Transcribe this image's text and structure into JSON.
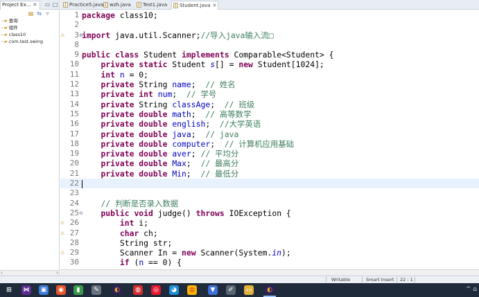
{
  "explorer": {
    "tab_label": "Project Ex...",
    "tab_close": "✕",
    "tree": [
      {
        "label": "查询",
        "arrow": "›"
      },
      {
        "label": "组件",
        "arrow": "›"
      },
      {
        "label": "class10",
        "arrow": "›"
      },
      {
        "label": "com.test.swing",
        "arrow": "›"
      }
    ]
  },
  "editor": {
    "tabs": [
      {
        "label": "Practice5.java",
        "active": false
      },
      {
        "label": "wzh.java",
        "active": false
      },
      {
        "label": "Test1.java",
        "active": false
      },
      {
        "label": "Student.java",
        "active": true
      }
    ],
    "active_tab_close": "✕",
    "lines": [
      {
        "n": "1",
        "html": "<span class=\"kw\">package</span> class10;"
      },
      {
        "n": "2",
        "html": ""
      },
      {
        "n": "3",
        "marker": "⚠",
        "fold": "⊕",
        "html": "<span class=\"kw\">import</span> java.util.Scanner;<span class=\"cm\">//导入java输入流□</span>"
      },
      {
        "n": "8",
        "html": ""
      },
      {
        "n": "9",
        "html": "<span class=\"kw\">public class</span> Student <span class=\"kw\">implements</span> Comparable&lt;Student&gt; {"
      },
      {
        "n": "10",
        "html": "    <span class=\"kw\">private static</span> Student <span class=\"sfld\">s</span>[] = <span class=\"kw\">new</span> Student[1024];"
      },
      {
        "n": "11",
        "html": "    <span class=\"kw\">int</span> <span class=\"fld\">n</span> = 0;"
      },
      {
        "n": "12",
        "html": "    <span class=\"kw\">private</span> String <span class=\"fld\">name</span>;  <span class=\"cm\">// 姓名</span>"
      },
      {
        "n": "13",
        "html": "    <span class=\"kw\">private int</span> <span class=\"fld\">num</span>;  <span class=\"cm\">// 学号</span>"
      },
      {
        "n": "14",
        "html": "    <span class=\"kw\">private</span> String <span class=\"fld\">classAge</span>;  <span class=\"cm\">// 班级</span>"
      },
      {
        "n": "15",
        "html": "    <span class=\"kw\">private double</span> <span class=\"fld\">math</span>;  <span class=\"cm\">// 高等数学</span>"
      },
      {
        "n": "16",
        "html": "    <span class=\"kw\">private double</span> <span class=\"fld\">english</span>;  <span class=\"cm\">//大学英语</span>"
      },
      {
        "n": "17",
        "html": "    <span class=\"kw\">private double</span> <span class=\"fld\">java</span>;  <span class=\"cm\">// java</span>"
      },
      {
        "n": "18",
        "html": "    <span class=\"kw\">private double</span> <span class=\"fld\">computer</span>;  <span class=\"cm\">// 计算机应用基础</span>"
      },
      {
        "n": "19",
        "html": "    <span class=\"kw\">private double</span> <span class=\"fld\">aver</span>; <span class=\"cm\">// 平均分</span>"
      },
      {
        "n": "20",
        "html": "    <span class=\"kw\">private double</span> <span class=\"fld\">Max</span>;  <span class=\"cm\">// 最高分</span>"
      },
      {
        "n": "21",
        "html": "    <span class=\"kw\">private double</span> <span class=\"fld\">Min</span>;  <span class=\"cm\">// 最低分</span>"
      },
      {
        "n": "22",
        "current": true,
        "html": "<span class=\"caret\"></span>"
      },
      {
        "n": "23",
        "html": ""
      },
      {
        "n": "24",
        "html": "    <span class=\"cm\">// 判断是否录入数据</span>"
      },
      {
        "n": "25",
        "fold": "⊖",
        "html": "    <span class=\"kw\">public void</span> judge() <span class=\"kw\">throws</span> IOException {"
      },
      {
        "n": "26",
        "marker": "⚠",
        "html": "        <span class=\"kw\">int</span> i;"
      },
      {
        "n": "27",
        "marker": "⚠",
        "html": "        <span class=\"kw\">char</span> ch;"
      },
      {
        "n": "28",
        "html": "        String str;"
      },
      {
        "n": "29",
        "marker": "⚠",
        "html": "        Scanner In = <span class=\"kw\">new</span> Scanner(System.<span class=\"sfld\">in</span>);"
      },
      {
        "n": "30",
        "html": "        <span class=\"kw\">if</span> (<span class=\"fld\">n</span> == 0) {"
      }
    ]
  },
  "status": {
    "writable": "Writable",
    "insert_mode": "Smart Insert",
    "position": "22 : 1"
  },
  "taskbar": {
    "icons": [
      {
        "name": "windows-start-icon",
        "glyph": "⊞",
        "bg": "#1f2a3a",
        "color": "#ffffff"
      },
      {
        "name": "visual-studio-icon",
        "glyph": "⋈",
        "bg": "#5b2d8e",
        "color": "#ffffff"
      },
      {
        "name": "files-app-icon",
        "glyph": "▣",
        "bg": "#3a7bd5",
        "color": "#ffffff"
      },
      {
        "name": "app-red-icon",
        "glyph": "◉",
        "bg": "#e4572e",
        "color": "#ffffff"
      },
      {
        "name": "app-green-icon",
        "glyph": "▮",
        "bg": "#3a9a4a",
        "color": "#ffffff"
      },
      {
        "name": "app-gray-icon",
        "glyph": "✎",
        "bg": "#6a7180",
        "color": "#ffffff"
      },
      {
        "name": "eclipse-icon",
        "glyph": "◐",
        "bg": "#2c2255",
        "color": "#f0a030"
      },
      {
        "name": "netease-music-icon",
        "glyph": "◍",
        "bg": "#d32f2f",
        "color": "#ffffff"
      },
      {
        "name": "weibo-icon",
        "glyph": "◎",
        "bg": "#e6162d",
        "color": "#ffffff"
      },
      {
        "name": "qq-icon",
        "glyph": "◕",
        "bg": "#1e8cd6",
        "color": "#ffffff"
      },
      {
        "name": "chrome-icon",
        "glyph": "◍",
        "bg": "#f4b400",
        "color": "#db4437"
      },
      {
        "name": "vpn-icon",
        "glyph": "▼",
        "bg": "#3d6fd9",
        "color": "#ffffff"
      },
      {
        "name": "notes-icon",
        "glyph": "✐",
        "bg": "#5a6470",
        "color": "#ffffff"
      },
      {
        "name": "file-explorer-icon",
        "glyph": "▭",
        "bg": "#e0b23a",
        "color": "#ffffff"
      },
      {
        "name": "eclipse-active-icon",
        "glyph": "◐",
        "bg": "#2c2255",
        "color": "#f0a030",
        "active": true
      }
    ],
    "tray": "^ ⌂"
  }
}
